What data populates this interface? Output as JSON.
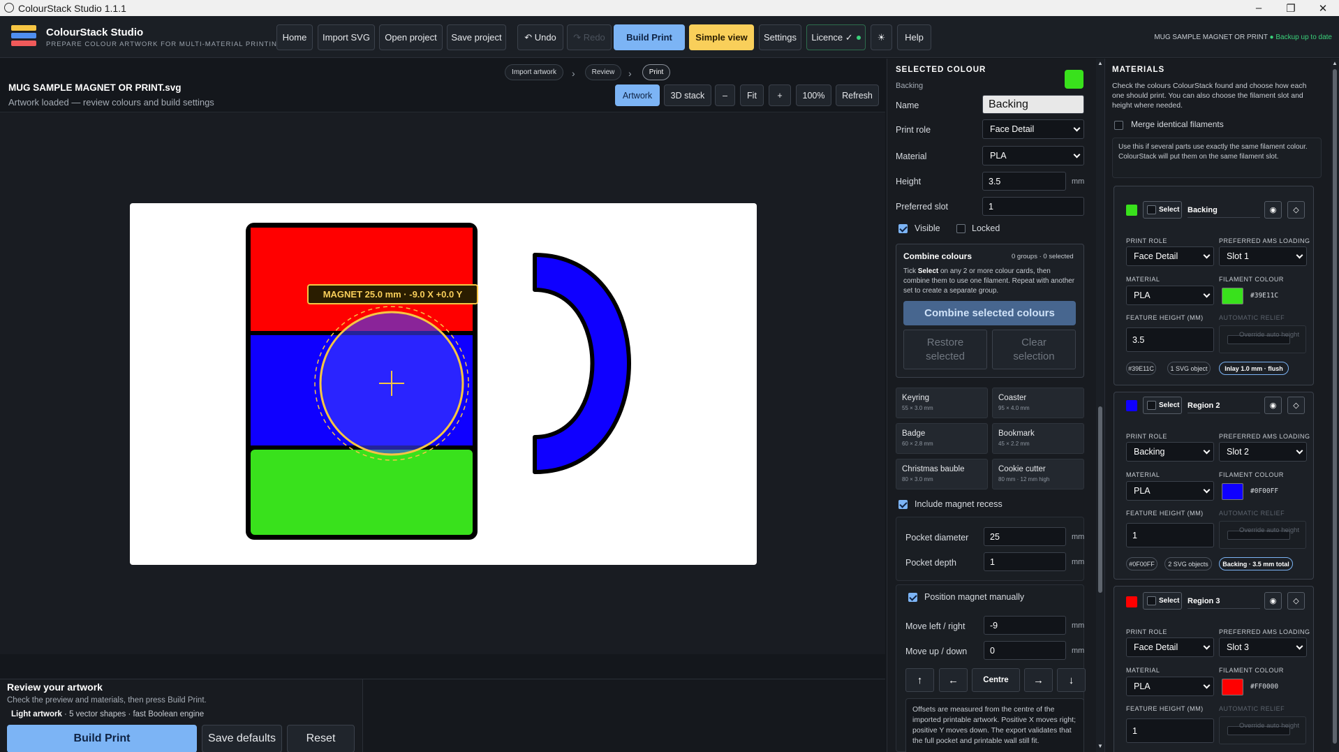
{
  "window": {
    "title": "ColourStack Studio 1.1.1"
  },
  "app": {
    "name": "ColourStack Studio",
    "tagline": "PREPARE COLOUR ARTWORK FOR MULTI-MATERIAL PRINTING"
  },
  "toolbar": {
    "home": "Home",
    "import_svg": "Import SVG",
    "open_project": "Open project",
    "save_project": "Save project",
    "undo": "↶ Undo",
    "redo": "↷ Redo",
    "build_print": "Build Print",
    "simple_view": "Simple view",
    "settings": "Settings",
    "licence": "Licence ✓",
    "theme": "☀",
    "help": "Help"
  },
  "status": {
    "file": "MUG SAMPLE MAGNET OR PRINT",
    "saved": "Backup up to date"
  },
  "breadcrumb": [
    "Import artwork",
    "Review",
    "Print"
  ],
  "file": {
    "title": "MUG SAMPLE MAGNET OR PRINT.svg",
    "subtitle": "Artwork loaded — review colours and build settings"
  },
  "view": {
    "artwork": "Artwork",
    "stack3d": "3D stack",
    "zoom_out": "–",
    "fit": "Fit",
    "zoom_in": "+",
    "zoom": "100%",
    "refresh": "Refresh"
  },
  "canvas": {
    "magnet_label": "MAGNET 25.0 mm · -9.0 X  +0.0 Y"
  },
  "bottom": {
    "title": "Review your artwork",
    "subtitle": "Check the preview and materials, then press Build Print.",
    "engine_strong": "Light artwork",
    "engine_rest": " · 5 vector shapes · fast Boolean engine",
    "build": "Build Print",
    "save_defaults": "Save defaults",
    "reset": "Reset"
  },
  "selected": {
    "title": "SELECTED COLOUR",
    "subtitle": "Backing",
    "swatch": "#39E11C",
    "name_label": "Name",
    "name_value": "Backing",
    "role_label": "Print role",
    "role_value": "Face Detail",
    "material_label": "Material",
    "material_value": "PLA",
    "height_label": "Height",
    "height_value": "3.5",
    "height_unit": "mm",
    "slot_label": "Preferred slot",
    "slot_value": "1",
    "visible": "Visible",
    "locked": "Locked"
  },
  "combine": {
    "title": "Combine colours",
    "count": "0 groups · 0 selected",
    "help_pre": "Tick ",
    "help_bold": "Select",
    "help_post": " on any 2 or more colour cards, then combine them to use one filament. Repeat with another set to create a separate group.",
    "combine_btn": "Combine selected colours",
    "restore_btn": "Restore selected",
    "clear_btn": "Clear selection"
  },
  "presets": [
    {
      "name": "Keyring",
      "size": "55 × 3.0 mm"
    },
    {
      "name": "Coaster",
      "size": "95 × 4.0 mm"
    },
    {
      "name": "Badge",
      "size": "60 × 2.8 mm"
    },
    {
      "name": "Bookmark",
      "size": "45 × 2.2 mm"
    },
    {
      "name": "Christmas bauble",
      "size": "80 × 3.0 mm"
    },
    {
      "name": "Cookie cutter",
      "size": "80 mm · 12 mm high"
    }
  ],
  "magnet": {
    "include": "Include magnet recess",
    "diameter_label": "Pocket diameter",
    "diameter_value": "25",
    "depth_label": "Pocket depth",
    "depth_value": "1",
    "unit": "mm",
    "manual": "Position magnet manually",
    "lr_label": "Move left / right",
    "lr_value": "-9",
    "ud_label": "Move up / down",
    "ud_value": "0",
    "up": "↑",
    "left": "←",
    "centre": "Centre",
    "right": "→",
    "down": "↓",
    "note": "Offsets are measured from the centre of the imported printable artwork. Positive X moves right; positive Y moves down. The export validates that the full pocket and printable wall still fit."
  },
  "materials": {
    "title": "MATERIALS",
    "help": "Check the colours ColourStack found and choose how each one should print. You can also choose the filament slot and height where needed.",
    "merge": "Merge identical filaments",
    "merge_help": "Use this if several parts use exactly the same filament colour. ColourStack will put them on the same filament slot.",
    "labels": {
      "select": "Select",
      "role": "PRINT ROLE",
      "ams": "PREFERRED AMS LOADING",
      "material": "MATERIAL",
      "colour": "FILAMENT COLOUR",
      "height": "FEATURE HEIGHT (MM)",
      "relief": "AUTOMATIC RELIEF",
      "override": "Override auto height"
    },
    "cards": [
      {
        "name": "Backing",
        "color": "#39E11C",
        "role": "Face Detail",
        "slot": "Slot 1",
        "material": "PLA",
        "hex": "#39E11C",
        "height": "3.5",
        "tag_hex": "#39E11C",
        "tag_obj": "1 SVG object",
        "tag_mode": "Inlay 1.0 mm · flush"
      },
      {
        "name": "Region 2",
        "color": "#0F00FF",
        "role": "Backing",
        "slot": "Slot 2",
        "material": "PLA",
        "hex": "#0F00FF",
        "height": "1",
        "tag_hex": "#0F00FF",
        "tag_obj": "2 SVG objects",
        "tag_mode": "Backing · 3.5 mm total"
      },
      {
        "name": "Region 3",
        "color": "#FF0000",
        "role": "Face Detail",
        "slot": "Slot 3",
        "material": "PLA",
        "hex": "#FF0000",
        "height": "1"
      }
    ]
  },
  "icons": {
    "eye": "eye-icon",
    "diamond": "diamond-icon",
    "globe": "globe-icon"
  }
}
